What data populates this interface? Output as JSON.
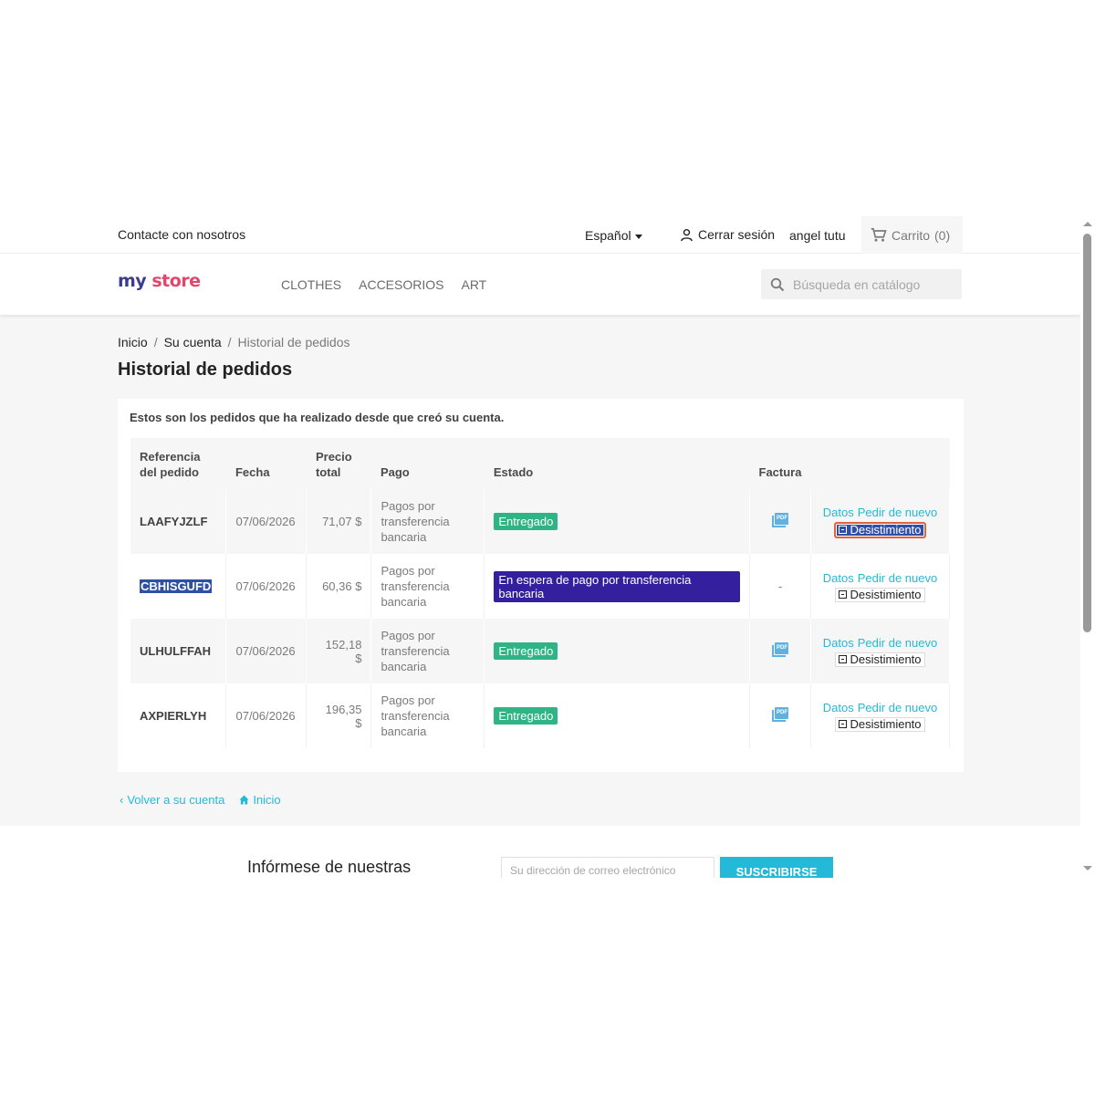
{
  "topbar": {
    "contact": "Contacte con nosotros",
    "language": "Español",
    "logout": "Cerrar sesión",
    "username": "angel tutu",
    "cart": "Carrito",
    "cart_count": "(0)"
  },
  "header": {
    "logo_my": "my",
    "logo_store": "store",
    "menu": [
      "CLOTHES",
      "ACCESORIOS",
      "ART"
    ],
    "search_placeholder": "Búsqueda en catálogo"
  },
  "breadcrumb": [
    "Inicio",
    "Su cuenta",
    "Historial de pedidos"
  ],
  "page_title": "Historial de pedidos",
  "intro": "Estos son los pedidos que ha realizado desde que creó su cuenta.",
  "table": {
    "headers": {
      "ref_line1": "Referencia",
      "ref_line2": "del pedido",
      "date": "Fecha",
      "price_line1": "Precio",
      "price_line2": "total",
      "payment": "Pago",
      "status": "Estado",
      "invoice": "Factura"
    },
    "rows": [
      {
        "ref": "LAAFYJZLF",
        "date": "07/06/2026",
        "price": "71,07 $",
        "pay1": "Pagos por",
        "pay2": "transferencia",
        "pay3": "bancaria",
        "status": "Entregado",
        "invoice": "pdf"
      },
      {
        "ref": "CBHISGUFD",
        "date": "07/06/2026",
        "price": "60,36 $",
        "pay1": "Pagos por",
        "pay2": "transferencia",
        "pay3": "bancaria",
        "status": "En espera de pago por transferencia bancaria",
        "invoice": "-"
      },
      {
        "ref": "ULHULFFAH",
        "date": "07/06/2026",
        "price": "152,18 $",
        "pay1": "Pagos por",
        "pay2": "transferencia",
        "pay3": "bancaria",
        "status": "Entregado",
        "invoice": "pdf"
      },
      {
        "ref": "AXPIERLYH",
        "date": "07/06/2026",
        "price": "196,35 $",
        "pay1": "Pagos por",
        "pay2": "transferencia",
        "pay3": "bancaria",
        "status": "Entregado",
        "invoice": "pdf"
      }
    ],
    "action_details": "Datos",
    "action_reorder": "Pedir de nuevo",
    "action_withdraw": "Desistimiento",
    "status_colors": {
      "delivered": "#2fb585",
      "awaiting": "#34209e"
    }
  },
  "footer_links": {
    "back": "Volver a su cuenta",
    "home": "Inicio"
  },
  "newsletter": {
    "text": "Infórmese de nuestras",
    "email_placeholder": "Su dirección de correo electrónico",
    "button": "SUSCRIBIRSE"
  },
  "icons": [
    "user-icon",
    "cart-icon",
    "search-icon",
    "pdf-icon",
    "withdraw-icon",
    "chevron-left-icon",
    "home-icon"
  ],
  "colors": {
    "accent": "#24b9d7",
    "selection": "#2f50a7",
    "focus_ring": "#e0623f"
  }
}
